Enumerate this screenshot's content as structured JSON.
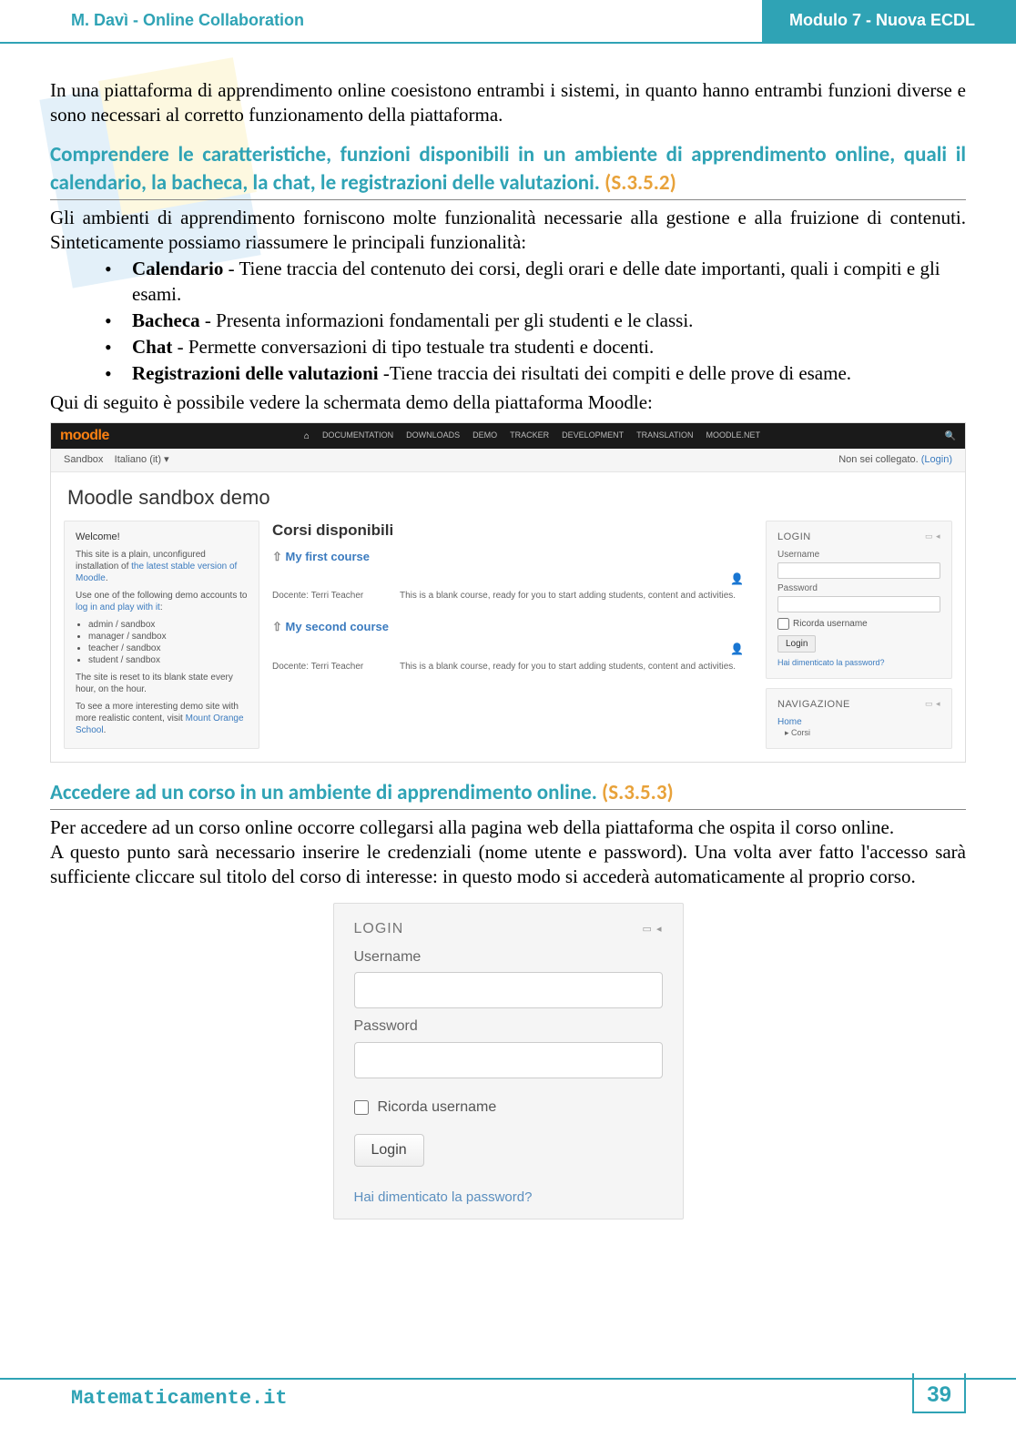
{
  "header": {
    "left": "M. Davì - Online Collaboration",
    "right": "Modulo 7 - Nuova ECDL"
  },
  "intro": "In una piattaforma di apprendimento online coesistono entrambi i sistemi, in quanto hanno entrambi funzioni diverse e sono necessari al corretto funzionamento della piattaforma.",
  "section1": {
    "title": "Comprendere le caratteristiche, funzioni disponibili in un ambiente di apprendimento online, quali il calendario, la bacheca, la chat, le registrazioni delle valutazioni.",
    "ref": "(S.3.5.2)",
    "lead": "Gli ambienti di apprendimento forniscono molte funzionalità necessarie alla gestione e alla fruizione di contenuti. Sinteticamente possiamo riassumere le principali funzionalità:",
    "items": [
      {
        "term": "Calendario",
        "desc": " - Tiene traccia del contenuto dei corsi, degli orari e delle date importanti, quali i compiti e gli esami."
      },
      {
        "term": "Bacheca",
        "desc": " - Presenta informazioni fondamentali per gli studenti e le classi."
      },
      {
        "term": "Chat",
        "desc": " - Permette conversazioni di tipo testuale tra studenti e docenti."
      },
      {
        "term": "Registrazioni delle valutazioni",
        "desc": " -Tiene traccia dei risultati dei compiti e delle prove di esame."
      }
    ],
    "outro": "Qui di seguito è possibile vedere la schermata demo della piattaforma Moodle:"
  },
  "moodle": {
    "logo": "moodle",
    "nav": [
      "DOCUMENTATION",
      "DOWNLOADS",
      "DEMO",
      "TRACKER",
      "DEVELOPMENT",
      "TRANSLATION",
      "MOODLE.NET"
    ],
    "breadcrumb": "Sandbox",
    "lang": "Italiano (it) ▾",
    "loginStatus": "Non sei collegato.",
    "loginLink": "(Login)",
    "title": "Moodle sandbox demo",
    "welcome": {
      "title": "Welcome!",
      "line1a": "This site is a plain, unconfigured installation of ",
      "line1b": "the latest stable version of Moodle",
      "line2": "Use one of the following demo accounts to ",
      "line2b": "log in and play with it",
      "accounts": [
        "admin / sandbox",
        "manager / sandbox",
        "teacher / sandbox",
        "student / sandbox"
      ],
      "line3": "The site is reset to its blank state every hour, on the hour.",
      "line4a": "To see a more interesting demo site with more realistic content, visit ",
      "line4b": "Mount Orange School"
    },
    "coursesTitle": "Corsi disponibili",
    "courses": [
      {
        "title": "My first course",
        "teacher": "Docente: Terri Teacher",
        "desc": "This is a blank course, ready for you to start adding students, content and activities."
      },
      {
        "title": "My second course",
        "teacher": "Docente: Terri Teacher",
        "desc": "This is a blank course, ready for you to start adding students, content and activities."
      }
    ],
    "loginBox": {
      "title": "LOGIN",
      "user": "Username",
      "pass": "Password",
      "remember": "Ricorda username",
      "button": "Login",
      "forgot": "Hai dimenticato la password?"
    },
    "navBox": {
      "title": "NAVIGAZIONE",
      "home": "Home",
      "sub": "▸ Corsi"
    }
  },
  "section2": {
    "title": "Accedere ad un corso in un ambiente di apprendimento online.",
    "ref": "(S.3.5.3)",
    "p1": "Per accedere ad un corso online occorre collegarsi alla pagina web della piattaforma che ospita il corso online.",
    "p2": "A questo punto sarà necessario inserire le credenziali (nome utente e password). Una volta aver fatto l'accesso sarà sufficiente cliccare sul titolo del corso di interesse: in questo modo si accederà automaticamente al proprio corso."
  },
  "loginFig": {
    "title": "LOGIN",
    "user": "Username",
    "pass": "Password",
    "remember": "Ricorda username",
    "button": "Login",
    "forgot": "Hai dimenticato la password?"
  },
  "footer": {
    "site": "Matematicamente.it",
    "page": "39"
  }
}
